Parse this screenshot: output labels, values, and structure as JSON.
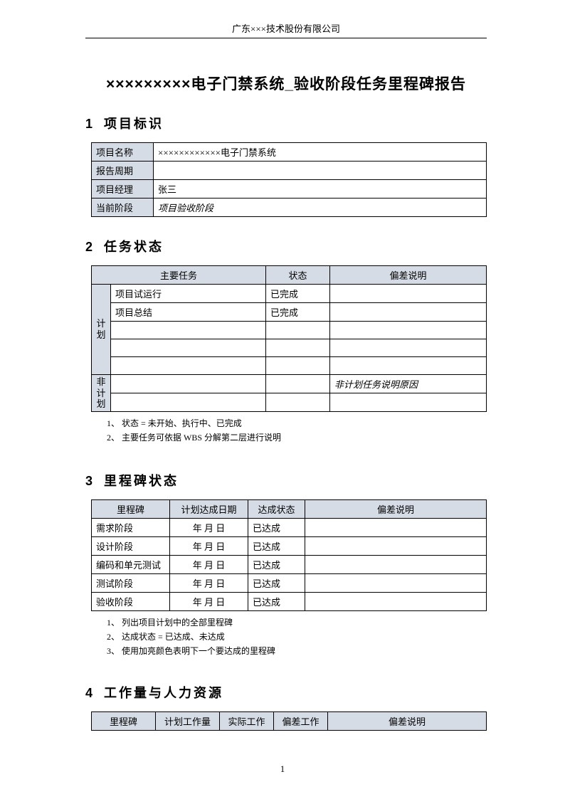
{
  "header": {
    "company": "广东×××技术股份有限公司"
  },
  "title": "×××××××××电子门禁系统_验收阶段任务里程碑报告",
  "page_number": "1",
  "section1": {
    "num": "1",
    "heading": "项目标识",
    "rows": {
      "name_label": "项目名称",
      "name_value": "××××××××××××电子门禁系统",
      "period_label": "报告周期",
      "period_value": "",
      "pm_label": "项目经理",
      "pm_value": "张三",
      "phase_label": "当前阶段",
      "phase_value": "项目验收阶段"
    }
  },
  "section2": {
    "num": "2",
    "heading": "任务状态",
    "headers": {
      "task": "主要任务",
      "status": "状态",
      "deviation": "偏差说明"
    },
    "side": {
      "plan": "计划",
      "nonplan": "非计划"
    },
    "rows": [
      {
        "task": "项目试运行",
        "status": "已完成",
        "dev": ""
      },
      {
        "task": "项目总结",
        "status": "已完成",
        "dev": ""
      },
      {
        "task": "",
        "status": "",
        "dev": ""
      },
      {
        "task": "",
        "status": "",
        "dev": ""
      },
      {
        "task": "",
        "status": "",
        "dev": ""
      }
    ],
    "nonplan_dev": "非计划任务说明原因",
    "notes": [
      "1、 状态 = 未开始、执行中、已完成",
      "2、 主要任务可依据 WBS 分解第二层进行说明"
    ]
  },
  "section3": {
    "num": "3",
    "heading": "里程碑状态",
    "headers": {
      "ms": "里程碑",
      "plan_date": "计划达成日期",
      "status": "达成状态",
      "dev": "偏差说明"
    },
    "date_placeholder": "年   月   日",
    "rows": [
      {
        "ms": "需求阶段",
        "status": "已达成",
        "dev": ""
      },
      {
        "ms": "设计阶段",
        "status": "已达成",
        "dev": ""
      },
      {
        "ms": "编码和单元测试",
        "status": "已达成",
        "dev": ""
      },
      {
        "ms": "测试阶段",
        "status": "已达成",
        "dev": ""
      },
      {
        "ms": "验收阶段",
        "status": "已达成",
        "dev": ""
      }
    ],
    "notes": [
      "1、 列出项目计划中的全部里程碑",
      "2、 达成状态 = 已达成、未达成",
      "3、 使用加亮颜色表明下一个要达成的里程碑"
    ]
  },
  "section4": {
    "num": "4",
    "heading": "工作量与人力资源",
    "headers": {
      "ms": "里程碑",
      "plan_work": "计划工作量",
      "actual_work": "实际工作",
      "dev_work": "偏差工作",
      "dev_desc": "偏差说明"
    }
  }
}
